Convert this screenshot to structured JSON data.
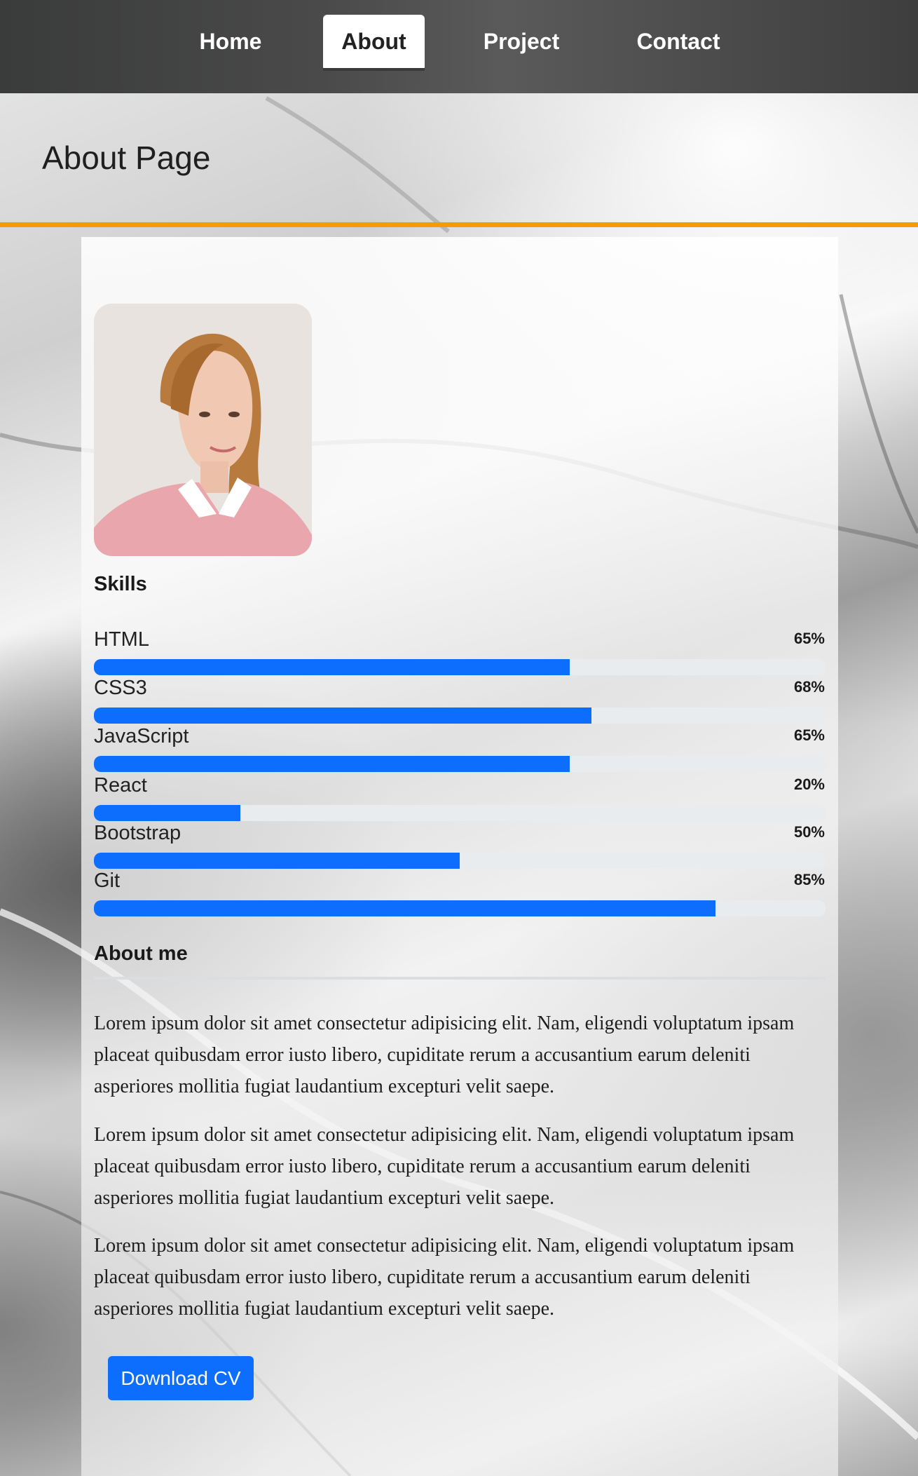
{
  "nav": {
    "items": [
      {
        "label": "Home",
        "active": false
      },
      {
        "label": "About",
        "active": true
      },
      {
        "label": "Project",
        "active": false
      },
      {
        "label": "Contact",
        "active": false
      }
    ]
  },
  "header": {
    "title": "About Page"
  },
  "skills": {
    "heading": "Skills",
    "items": [
      {
        "name": "HTML",
        "percent_label": "65%",
        "level": 0.65
      },
      {
        "name": "CSS3",
        "percent_label": "68%",
        "level": 0.68
      },
      {
        "name": "JavaScript",
        "percent_label": "65%",
        "level": 0.65
      },
      {
        "name": "React",
        "percent_label": "20%",
        "level": 0.2
      },
      {
        "name": "Bootstrap",
        "percent_label": "50%",
        "level": 0.5
      },
      {
        "name": "Git",
        "percent_label": "85%",
        "level": 0.85
      }
    ]
  },
  "about": {
    "heading": "About me",
    "paragraphs": [
      "Lorem ipsum dolor sit amet consectetur adipisicing elit. Nam, eligendi voluptatum ipsam placeat quibusdam error iusto libero, cupiditate rerum a accusantium earum deleniti asperiores mollitia fugiat laudantium excepturi velit saepe.",
      "Lorem ipsum dolor sit amet consectetur adipisicing elit. Nam, eligendi voluptatum ipsam placeat quibusdam error iusto libero, cupiditate rerum a accusantium earum deleniti asperiores mollitia fugiat laudantium excepturi velit saepe.",
      "Lorem ipsum dolor sit amet consectetur adipisicing elit. Nam, eligendi voluptatum ipsam placeat quibusdam error iusto libero, cupiditate rerum a accusantium earum deleniti asperiores mollitia fugiat laudantium excepturi velit saepe."
    ],
    "download_label": "Download CV"
  },
  "colors": {
    "accent": "#0d6efd",
    "rule": "#f79a05",
    "navbar": "#3a3b3b"
  }
}
